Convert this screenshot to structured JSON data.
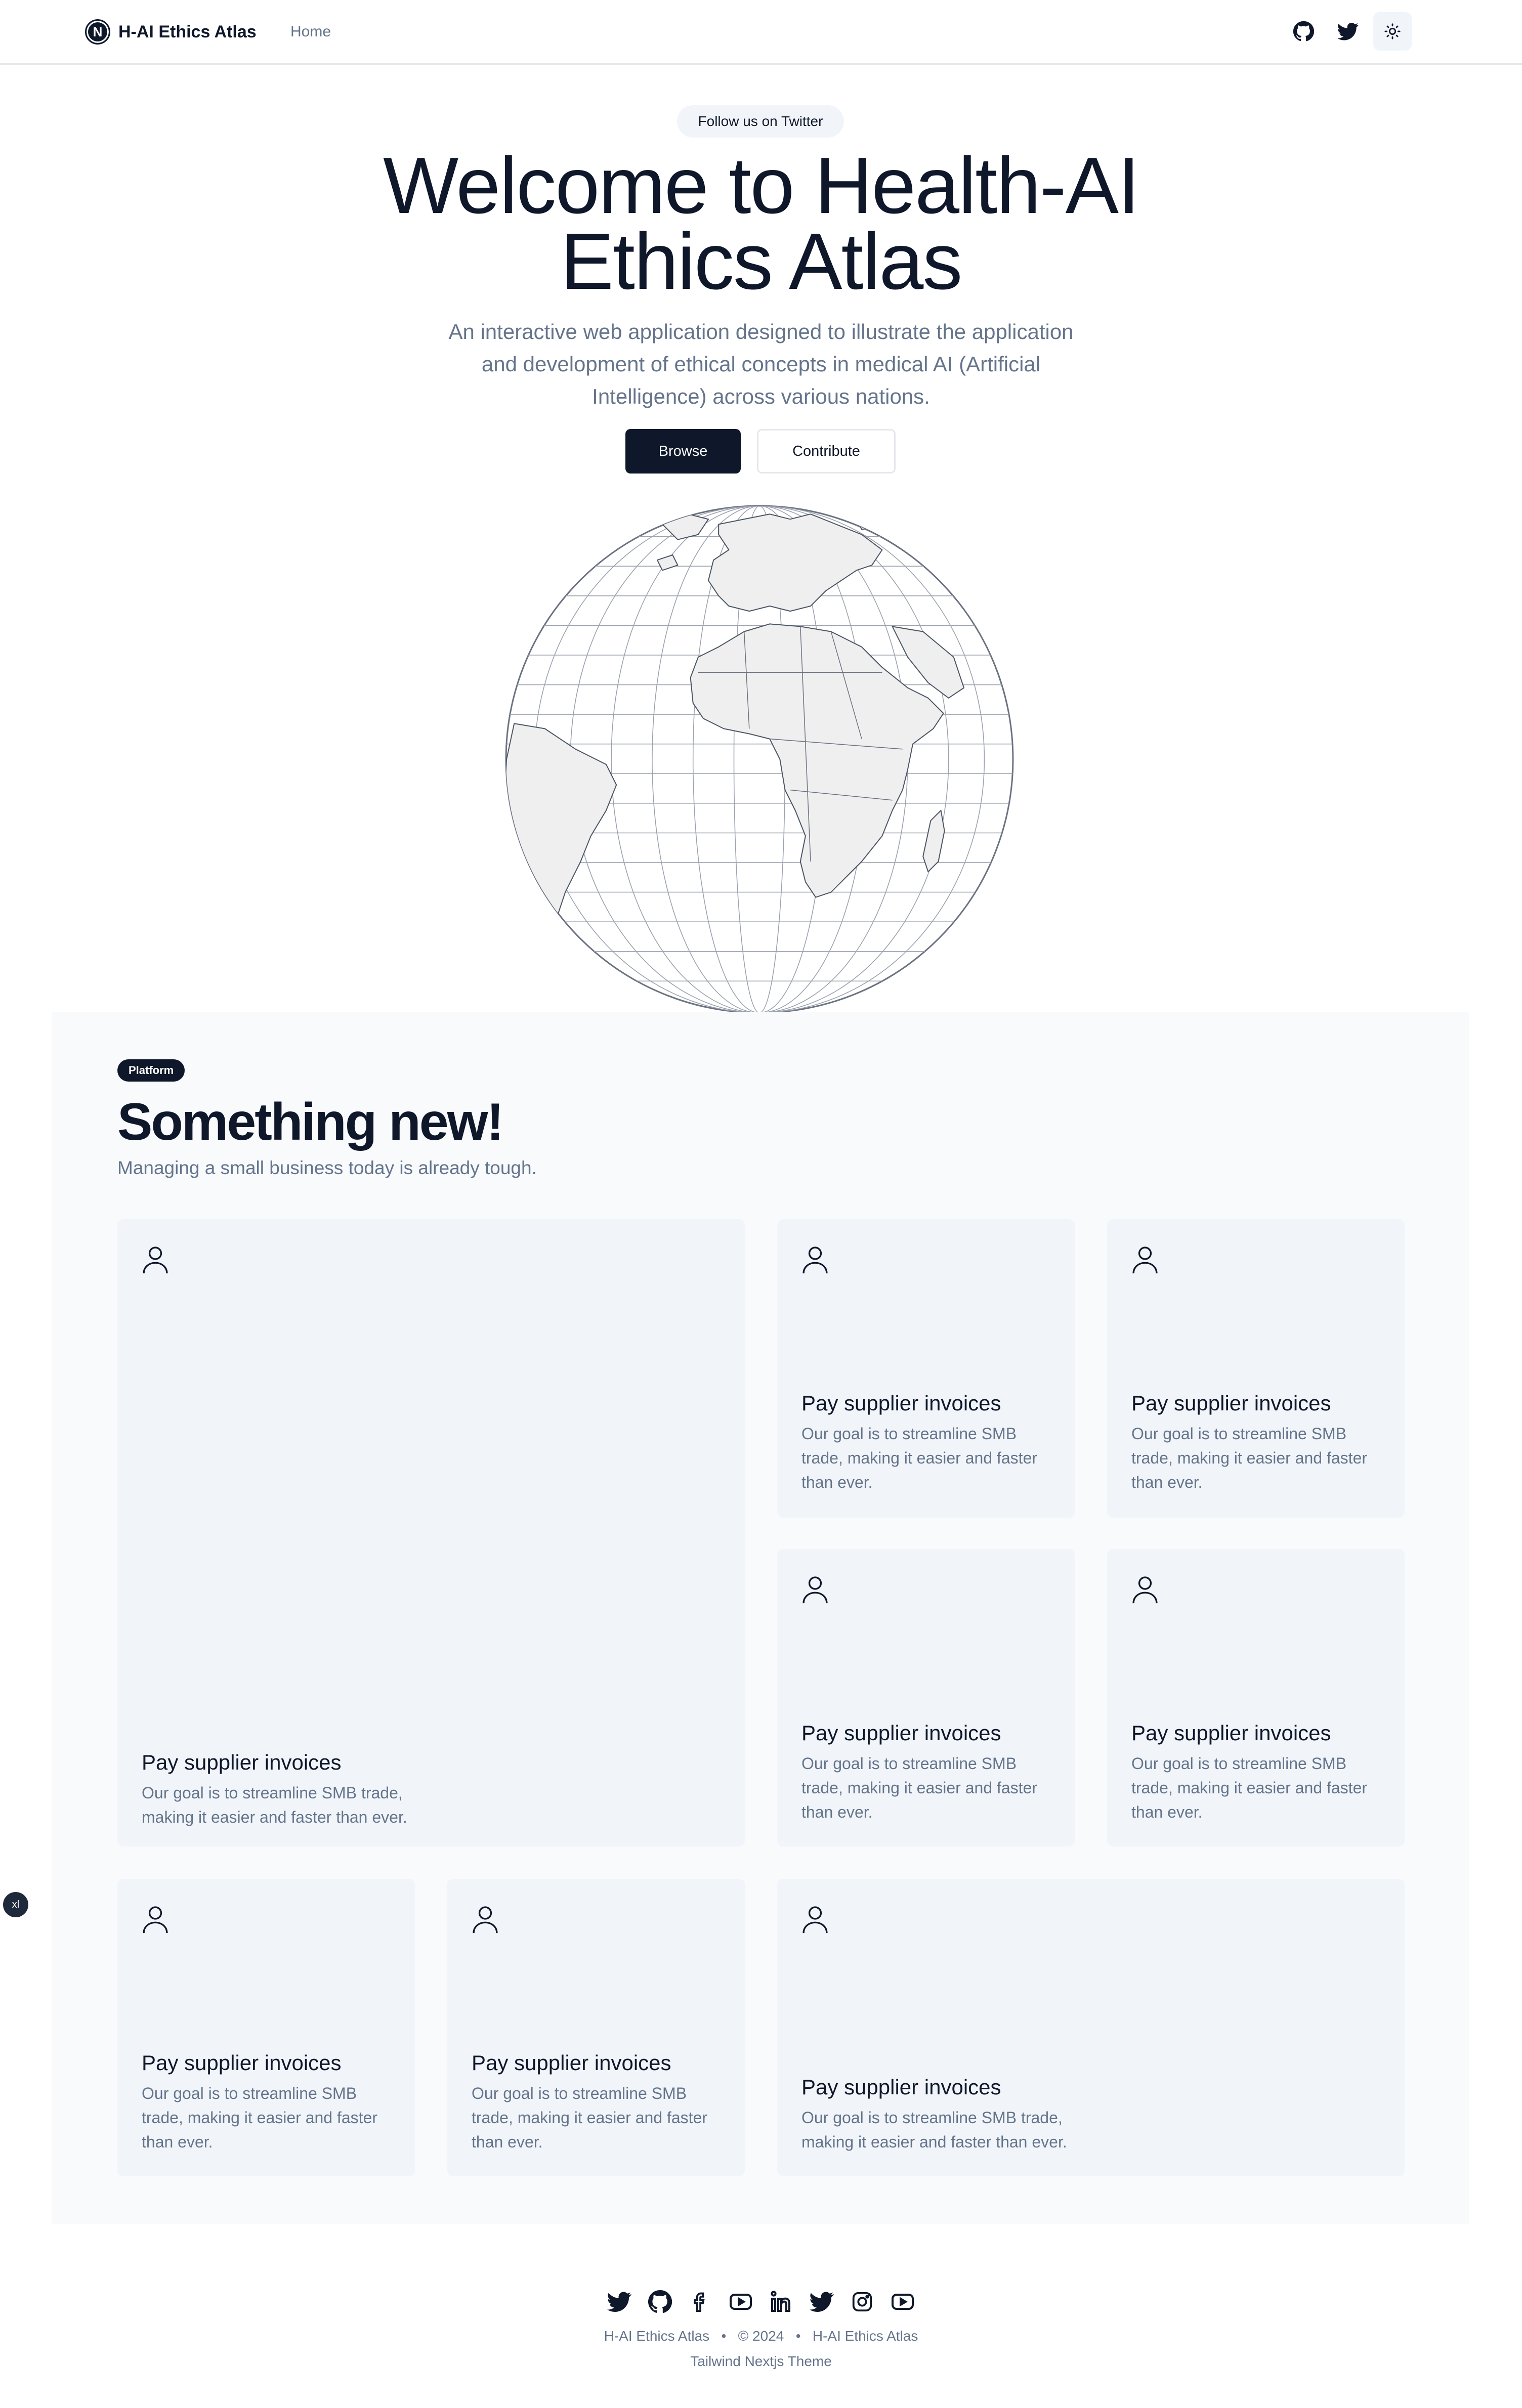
{
  "nav": {
    "brand_letter": "N",
    "brand_name": "H-AI Ethics Atlas",
    "links": [
      "Home"
    ],
    "icons": [
      "github-icon",
      "twitter-icon",
      "sun-icon"
    ]
  },
  "hero": {
    "pill": "Follow us on Twitter",
    "title_line1": "Welcome to Health-AI",
    "title_line2": "Ethics Atlas",
    "subtitle": "An interactive web application designed to illustrate the application and development of ethical concepts in medical AI (Artificial Intelligence) across various nations.",
    "primary_button": "Browse",
    "secondary_button": "Contribute"
  },
  "features": {
    "badge": "Platform",
    "title": "Something new!",
    "subtitle": "Managing a small business today is already tough.",
    "cards": [
      {
        "title": "Pay supplier invoices",
        "text": "Our goal is to streamline SMB trade, making it easier and faster than ever.",
        "icon": "user-icon"
      },
      {
        "title": "Pay supplier invoices",
        "text": "Our goal is to streamline SMB trade, making it easier and faster than ever.",
        "icon": "user-icon"
      },
      {
        "title": "Pay supplier invoices",
        "text": "Our goal is to streamline SMB trade, making it easier and faster than ever.",
        "icon": "user-icon"
      },
      {
        "title": "Pay supplier invoices",
        "text": "Our goal is to streamline SMB trade, making it easier and faster than ever.",
        "icon": "user-icon"
      },
      {
        "title": "Pay supplier invoices",
        "text": "Our goal is to streamline SMB trade, making it easier and faster than ever.",
        "icon": "user-icon"
      },
      {
        "title": "Pay supplier invoices",
        "text": "Our goal is to streamline SMB trade, making it easier and faster than ever.",
        "icon": "user-icon"
      },
      {
        "title": "Pay supplier invoices",
        "text": "Our goal is to streamline SMB trade, making it easier and faster than ever.",
        "icon": "user-icon"
      },
      {
        "title": "Pay supplier invoices",
        "text": "Our goal is to streamline SMB trade, making it easier and faster than ever.",
        "icon": "user-icon"
      }
    ]
  },
  "footer": {
    "icons": [
      "twitter-icon",
      "github-icon",
      "facebook-icon",
      "youtube-icon",
      "linkedin-icon",
      "twitter-icon",
      "instagram-icon",
      "youtube-icon"
    ],
    "site_name": "H-AI Ethics Atlas",
    "bullet": "•",
    "copyright": "© 2024",
    "site_name_2": "H-AI Ethics Atlas",
    "theme_credit": "Tailwind Nextjs Theme"
  },
  "floating_badge": "xl",
  "colors": {
    "primary": "#0f172a",
    "muted": "#64748b",
    "card_bg": "#f1f5f9",
    "section_bg": "#f8fafc"
  }
}
